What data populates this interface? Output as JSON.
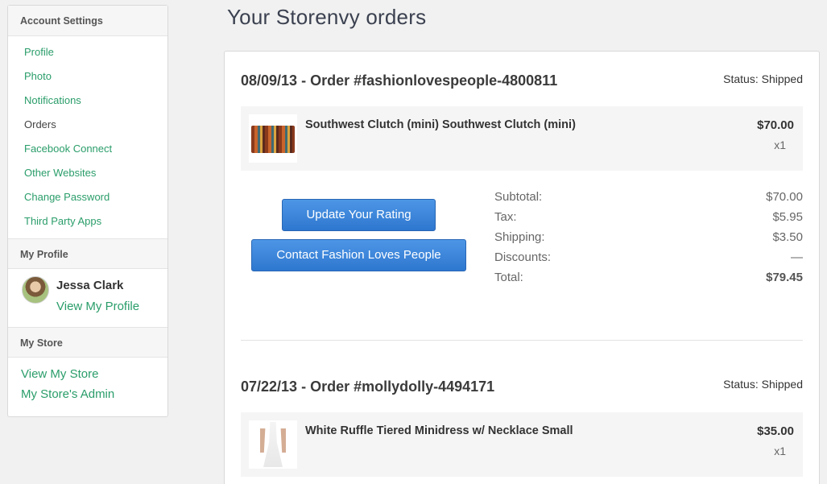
{
  "sidebar": {
    "account_heading": "Account Settings",
    "nav": [
      {
        "label": "Profile"
      },
      {
        "label": "Photo"
      },
      {
        "label": "Notifications"
      },
      {
        "label": "Orders"
      },
      {
        "label": "Facebook Connect"
      },
      {
        "label": "Other Websites"
      },
      {
        "label": "Change Password"
      },
      {
        "label": "Third Party Apps"
      }
    ],
    "active_item": "Orders",
    "profile_heading": "My Profile",
    "profile_name": "Jessa Clark",
    "profile_link": "View My Profile",
    "store_heading": "My Store",
    "store_links": [
      "View My Store",
      "My Store's Admin"
    ]
  },
  "main": {
    "title": "Your Storenvy orders",
    "orders": [
      {
        "title": "08/09/13 - Order #fashionlovespeople-4800811",
        "status": "Status: Shipped",
        "item_name": "Southwest Clutch (mini) Southwest Clutch (mini)",
        "item_price": "$70.00",
        "item_qty": "x1",
        "rating_button": "Update Your Rating",
        "contact_button": "Contact Fashion Loves People",
        "totals": [
          {
            "label": "Subtotal:",
            "value": "$70.00"
          },
          {
            "label": "Tax:",
            "value": "$5.95"
          },
          {
            "label": "Shipping:",
            "value": "$3.50"
          },
          {
            "label": "Discounts:",
            "value": "—"
          },
          {
            "label": "Total:",
            "value": "$79.45"
          }
        ]
      },
      {
        "title": "07/22/13 - Order #mollydolly-4494171",
        "status": "Status: Shipped",
        "item_name": "White Ruffle Tiered Minidress w/ Necklace Small",
        "item_price": "$35.00",
        "item_qty": "x1"
      }
    ]
  },
  "colors": {
    "link": "#2a9d6a",
    "button": "#3a85db",
    "background": "#f1f1f1"
  }
}
